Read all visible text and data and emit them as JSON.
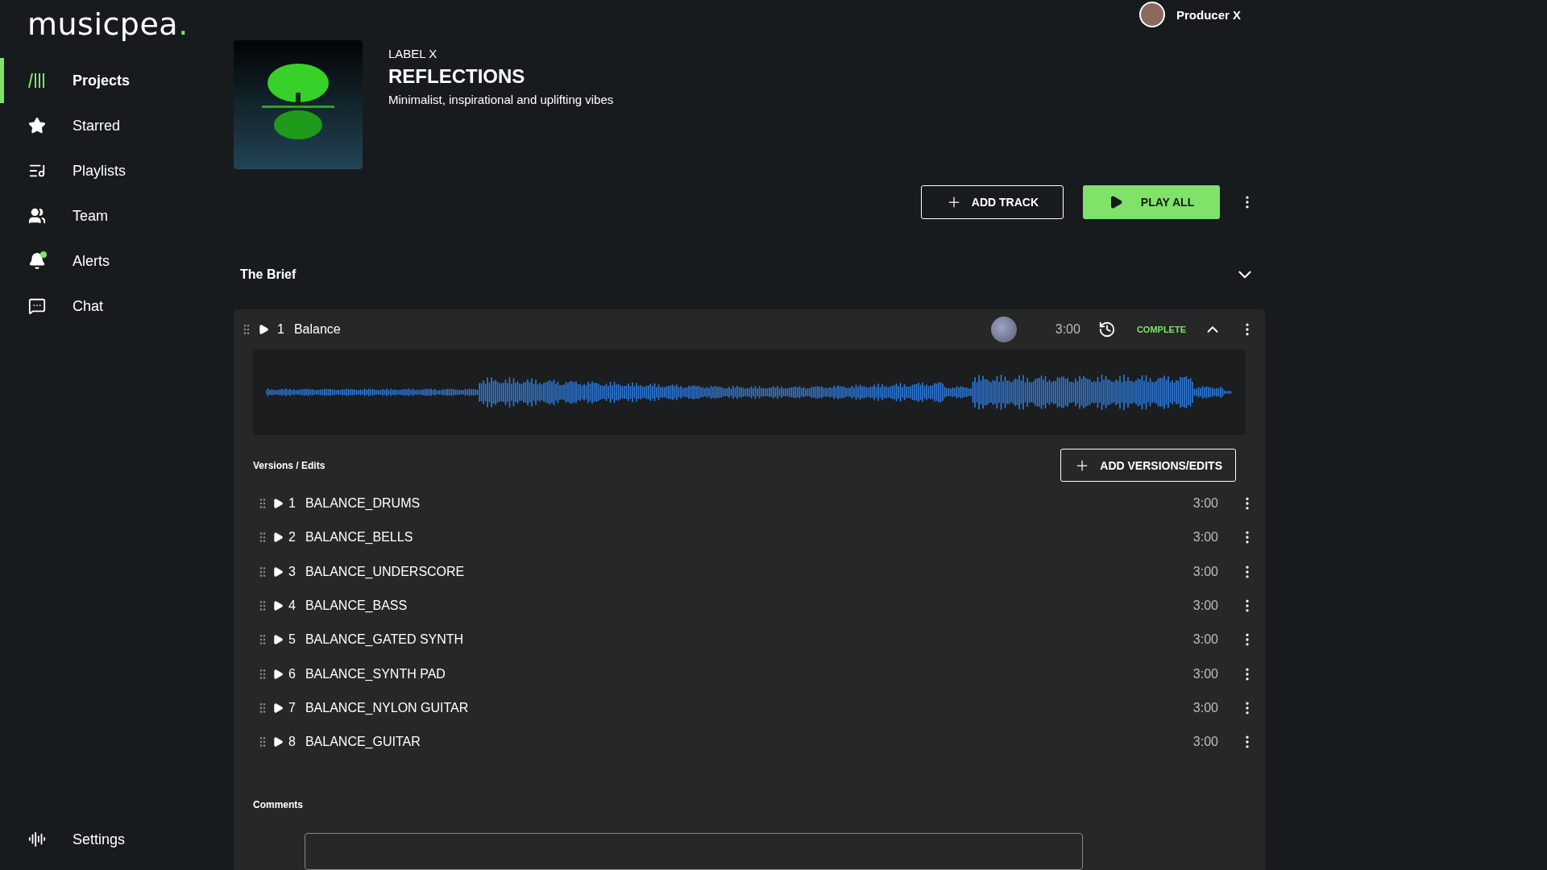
{
  "logo": {
    "text": "musicpea",
    "accent": "."
  },
  "nav": {
    "items": [
      {
        "kind": "projects",
        "label": "Projects",
        "selected": true,
        "notification": false
      },
      {
        "kind": "starred",
        "label": "Starred",
        "selected": false,
        "notification": false
      },
      {
        "kind": "playlists",
        "label": "Playlists",
        "selected": false,
        "notification": false
      },
      {
        "kind": "team",
        "label": "Team",
        "selected": false,
        "notification": false
      },
      {
        "kind": "alerts",
        "label": "Alerts",
        "selected": false,
        "notification": true
      },
      {
        "kind": "chat",
        "label": "Chat",
        "selected": false,
        "notification": false
      }
    ],
    "settings": {
      "label": "Settings"
    }
  },
  "user": {
    "name": "Producer X"
  },
  "project": {
    "label": "LABEL X",
    "title": "REFLECTIONS",
    "description": "Minimalist, inspirational and uplifting vibes"
  },
  "actions": {
    "add_track": "ADD TRACK",
    "play_all": "PLAY ALL"
  },
  "brief": {
    "title": "The Brief",
    "expanded": false
  },
  "track": {
    "number": "1",
    "title": "Balance",
    "duration": "3:00",
    "status": "COMPLETE",
    "expanded": true,
    "versions_title": "Versions / Edits",
    "add_versions": "ADD VERSIONS/EDITS",
    "versions": [
      {
        "number": "1",
        "title": "BALANCE_DRUMS",
        "duration": "3:00"
      },
      {
        "number": "2",
        "title": "BALANCE_BELLS",
        "duration": "3:00"
      },
      {
        "number": "3",
        "title": "BALANCE_UNDERSCORE",
        "duration": "3:00"
      },
      {
        "number": "4",
        "title": "BALANCE_BASS",
        "duration": "3:00"
      },
      {
        "number": "5",
        "title": "BALANCE_GATED SYNTH",
        "duration": "3:00"
      },
      {
        "number": "6",
        "title": "BALANCE_SYNTH PAD",
        "duration": "3:00"
      },
      {
        "number": "7",
        "title": "BALANCE_NYLON GUITAR",
        "duration": "3:00"
      },
      {
        "number": "8",
        "title": "BALANCE_GUITAR",
        "duration": "3:00"
      }
    ],
    "comments_title": "Comments"
  }
}
